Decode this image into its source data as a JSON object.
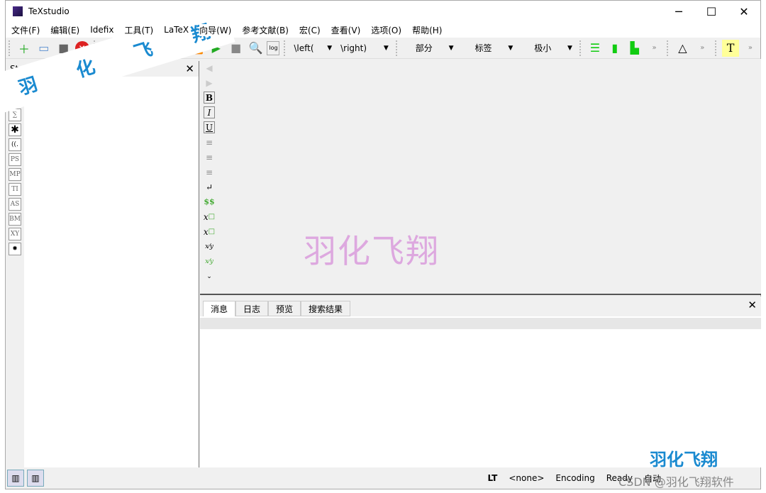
{
  "window": {
    "title": "TeXstudio",
    "minimize": "─",
    "maximize": "☐",
    "close": "✕"
  },
  "menu": [
    "文件(F)",
    "编辑(E)",
    "Idefix",
    "工具(T)",
    "LaTeX",
    "向导(W)",
    "参考文献(B)",
    "宏(C)",
    "查看(V)",
    "选项(O)",
    "帮助(H)"
  ],
  "toolbar": {
    "left_paren": "\\left(",
    "right_paren": "\\right)",
    "section": "部分",
    "label": "标签",
    "size": "极小",
    "more": "»",
    "log_label": "log"
  },
  "structure": {
    "title": "Structure",
    "close": "✕",
    "side_icons": [
      "PS",
      "MP",
      "TI",
      "AS",
      "BM",
      "XY"
    ]
  },
  "editor_icons": {
    "bold": "B",
    "italic": "I",
    "underline": "U",
    "math": "$$"
  },
  "bottom_tabs": [
    "消息",
    "日志",
    "预览",
    "搜索结果"
  ],
  "status": {
    "lt": "LT",
    "language": "<none>",
    "encoding": "Encoding",
    "ready": "Ready",
    "auto": "自动"
  },
  "watermarks": {
    "center": "羽化飞翔",
    "banner": [
      "羽",
      "化",
      "飞",
      "翔"
    ],
    "logo": "羽化飞翔",
    "credit": "CSDN @羽化飞翔软件"
  },
  "colors": {
    "watermark_pink": "#dda8df",
    "watermark_blue": "#1a8ad0",
    "highlight_yellow": "#ffff99"
  }
}
